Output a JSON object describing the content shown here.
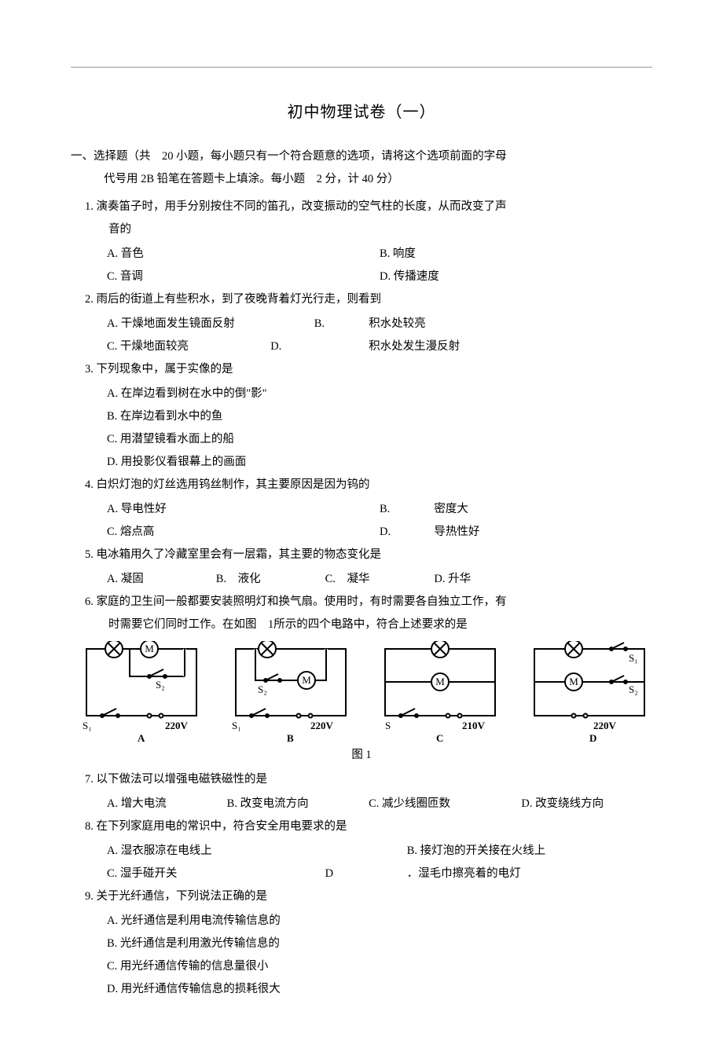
{
  "title": "初中物理试卷（一）",
  "section1": {
    "intro_line1": "一、选择题（共　20 小题，每小题只有一个符合题意的选项，请将这个选项前面的字母",
    "intro_line2": "代号用  2B 铅笔在答题卡上填涂。每小题　2 分，计  40 分）"
  },
  "q1": {
    "num": "1.",
    "text_line1": "演奏笛子时，用手分别按住不同的笛孔，改变振动的空气柱的长度，从而改变了声",
    "text_line2": "音的",
    "optA": "A. 音色",
    "optB": "B. 响度",
    "optC": "C. 音调",
    "optD": "D. 传播速度"
  },
  "q2": {
    "num": "2.",
    "text": "雨后的街道上有些积水，到了夜晚背着灯光行走，则看到",
    "optA": "A. 干燥地面发生镜面反射",
    "B_label": "B.",
    "optB": "积水处较亮",
    "optC": "C. 干燥地面较亮",
    "D_label": "D.",
    "optD": "积水处发生漫反射"
  },
  "q3": {
    "num": "3.",
    "text": "下列现象中，属于实像的是",
    "optA": "A. 在岸边看到树在水中的倒\"影\"",
    "optB": "B. 在岸边看到水中的鱼",
    "optC": "C. 用潜望镜看水面上的船",
    "optD": "D. 用投影仪看银幕上的画面"
  },
  "q4": {
    "num": "4.",
    "text": "白炽灯泡的灯丝选用钨丝制作，其主要原因是因为钨的",
    "optA": "A. 导电性好",
    "B_label": "B.",
    "optB": "密度大",
    "optC": "C. 熔点高",
    "D_label": "D.",
    "optD": "导热性好"
  },
  "q5": {
    "num": "5.",
    "text": "电冰箱用久了冷藏室里会有一层霜，其主要的物态变化是",
    "optA": "A. 凝固",
    "optB": "B.　液化",
    "optC": "C.　凝华",
    "optD": "D. 升华"
  },
  "q6": {
    "num": "6.",
    "text_line1": "家庭的卫生间一般都要安装照明灯和换气扇。使用时，有时需要各自独立工作，有",
    "text_line2": "时需要它们同时工作。在如图　1所示的四个电路中，符合上述要求的是"
  },
  "fig1": {
    "caption": "图  1",
    "labels": {
      "A": "A",
      "B": "B",
      "C": "C",
      "D": "D",
      "S": "S",
      "S1": "S₁",
      "S2": "S₂",
      "V1": "220V",
      "V2": "220V",
      "V3": "210V",
      "V4": "220V"
    }
  },
  "q7": {
    "num": "7.",
    "text": "以下做法可以增强电磁铁磁性的是",
    "optA": "A.  增大电流",
    "optB": "B.  改变电流方向",
    "optC": "C.  减少线圈匝数",
    "optD": "D.  改变绕线方向"
  },
  "q8": {
    "num": "8.",
    "text": "在下列家庭用电的常识中，符合安全用电要求的是",
    "optA": "A.  湿衣服凉在电线上",
    "optB": "B.  接灯泡的开关接在火线上",
    "optC": "C.  湿手碰开关",
    "D_label": "D",
    "optD": "．湿毛巾擦亮着的电灯"
  },
  "q9": {
    "num": "9.",
    "text": "关于光纤通信，下列说法正确的是",
    "optA": "A.  光纤通信是利用电流传输信息的",
    "optB": "B. 光纤通信是利用激光传输信息的",
    "optC": "C.  用光纤通信传输的信息量很小",
    "optD": "D.  用光纤通信传输信息的损耗很大"
  }
}
